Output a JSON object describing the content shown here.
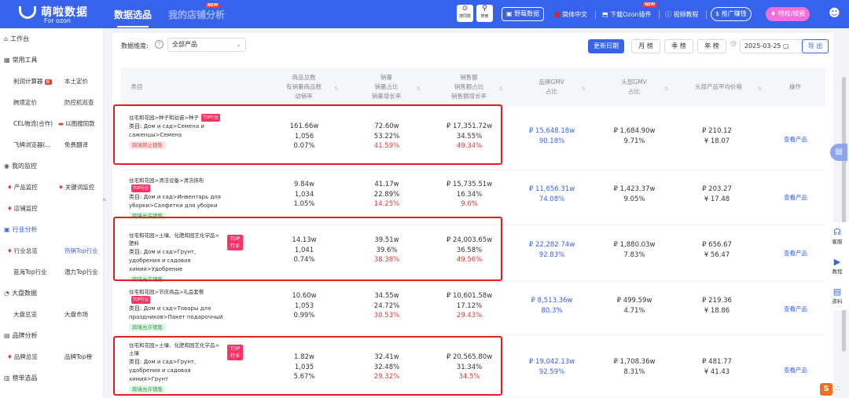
{
  "header": {
    "logo_title": "萌啦数据",
    "logo_sub": "For ozon",
    "nav_active": "数据选品",
    "nav_other": "我的店铺分析",
    "new_tag": "NEW",
    "tool1": "搜同款",
    "tool2": "搜索",
    "plugin_pill": "野莓数据",
    "language": "简体中文",
    "download": "下载Ozon插件",
    "video": "视频教程",
    "promote": "推广赚钱",
    "vip": "特权/续费"
  },
  "sidebar": {
    "workbench": "工作台",
    "tools_title": "常用工具",
    "tools": [
      [
        "利润计算器",
        "本土定价"
      ],
      [
        "跨境定价",
        "防控机巡查"
      ],
      [
        "CEL物流(合作)",
        "以图搜同款"
      ],
      [
        "飞牌浏览器(...",
        "免费翻译"
      ]
    ],
    "tools_badge": "新",
    "monitor_title": "我的监控",
    "monitor": [
      "产品监控",
      "关键词监控",
      "店铺监控"
    ],
    "industry_title": "行业分析",
    "industry": [
      [
        "行业总览",
        "热销Top行业"
      ],
      [
        "蓝海Top行业",
        "潜力Top行业"
      ]
    ],
    "market_title": "大盘数据",
    "market": [
      "大盘总览",
      "大盘市场"
    ],
    "brand_title": "品牌分析",
    "brand": [
      "品牌总览",
      "品牌Top榜"
    ],
    "list_title": "榜单选品"
  },
  "filters": {
    "label": "数据维度:",
    "select": "全部产品",
    "update_btn": "更新日期",
    "month_btn": "月 榜",
    "season_btn": "季 榜",
    "year_btn": "年 榜",
    "date": "2025-03-25",
    "export_btn": "导 出"
  },
  "table": {
    "headers": {
      "category": "类目",
      "count": [
        "商品总数",
        "有销量商品数",
        "动销率"
      ],
      "sales": [
        "销量",
        "销量占比",
        "销量增长率"
      ],
      "revenue": [
        "销售额",
        "销售额占比",
        "销售额增长率"
      ],
      "brand_gmv": [
        "品牌GMV",
        "占比"
      ],
      "top_gmv": [
        "头部GMV",
        "占比"
      ],
      "avg_price": [
        "头部产品平均价格"
      ],
      "action": "操作"
    },
    "top_label": "TOP行业",
    "top_big": "TOP行业",
    "view_label": "查看产品",
    "rows": [
      {
        "path": "住宅和花园>种子和幼苗>种子",
        "desc": "类目: Дом и сад>Семена и саженцы>Семена",
        "status": "跨境禁止销售",
        "status_type": "red",
        "count": [
          "161.66w",
          "1,056",
          "0.07%"
        ],
        "sales": [
          "72.60w",
          "53.22%",
          "41.59%"
        ],
        "revenue": [
          "₽ 17,351.72w",
          "34.55%",
          "49.34%"
        ],
        "brand": [
          "₽ 15,648.18w",
          "90.18%"
        ],
        "top": [
          "₽ 1,684.90w",
          "9.71%"
        ],
        "avg": [
          "₽ 210.12",
          "¥ 18.07"
        ]
      },
      {
        "path": "住宅和花园>清洁设备>清洁抹布",
        "desc": "类目: Дом и сад>Инвентарь для уборки>Салфетки для уборки",
        "status": "跨境允许销售",
        "status_type": "green",
        "count": [
          "9.84w",
          "1,034",
          "1.05%"
        ],
        "sales": [
          "41.17w",
          "22.89%",
          "14.25%"
        ],
        "revenue": [
          "₽ 15,735.51w",
          "16.34%",
          "9.6%"
        ],
        "brand": [
          "₽ 11,656.31w",
          "74.08%"
        ],
        "top": [
          "₽ 1,423.37w",
          "9.05%"
        ],
        "avg": [
          "₽ 203.27",
          "¥ 17.48"
        ]
      },
      {
        "path": "住宅和花园>土壤、化肥和园艺化学品>肥料",
        "desc": "类目: Дом и сад>Грунт, удобрения и садовая химия>Удобрение",
        "status": "跨境允许销售",
        "status_type": "green",
        "count": [
          "14.13w",
          "1,041",
          "0.74%"
        ],
        "sales": [
          "39.51w",
          "39.6%",
          "38.38%"
        ],
        "revenue": [
          "₽ 24,003.65w",
          "36.58%",
          "49.56%"
        ],
        "brand": [
          "₽ 22,282.74w",
          "92.83%"
        ],
        "top": [
          "₽ 1,880.03w",
          "7.83%"
        ],
        "avg": [
          "₽ 656.67",
          "¥ 56.47"
        ]
      },
      {
        "path": "住宅和花园>节庆商品>礼品套餐",
        "desc": "类目: Дом и сад>Товары для праздников>Пакет подарочный",
        "status": "跨境允许销售",
        "status_type": "green",
        "count": [
          "10.60w",
          "1,053",
          "0.99%"
        ],
        "sales": [
          "34.55w",
          "24.72%",
          "30.53%"
        ],
        "revenue": [
          "₽ 10,601.58w",
          "17.12%",
          "29.43%"
        ],
        "brand": [
          "₽ 8,513.36w",
          "80.3%"
        ],
        "top": [
          "₽ 499.59w",
          "4.71%"
        ],
        "avg": [
          "₽ 219.36",
          "¥ 18.86"
        ]
      },
      {
        "path": "住宅和花园>土壤、化肥和园艺化学品>土壤",
        "desc": "类目: Дом и сад>Грунт, удобрения и садовая химия>Грунт",
        "status": "跨境允许销售",
        "status_type": "green",
        "count": [
          "1.82w",
          "1,035",
          "5.67%"
        ],
        "sales": [
          "32.41w",
          "32.48%",
          "29.32%"
        ],
        "revenue": [
          "₽ 20,565.80w",
          "31.34%",
          "34.5%"
        ],
        "brand": [
          "₽ 19,042.13w",
          "92.59%"
        ],
        "top": [
          "₽ 1,708.36w",
          "8.31%"
        ],
        "avg": [
          "₽ 481.77",
          "¥ 41.43"
        ]
      }
    ]
  },
  "right_panel": {
    "service": "客服",
    "tutorial": "教程",
    "material": "资料"
  },
  "colors": {
    "primary": "#3662ec",
    "red_box": "#e02020",
    "growth_red": "#e23a3a"
  }
}
